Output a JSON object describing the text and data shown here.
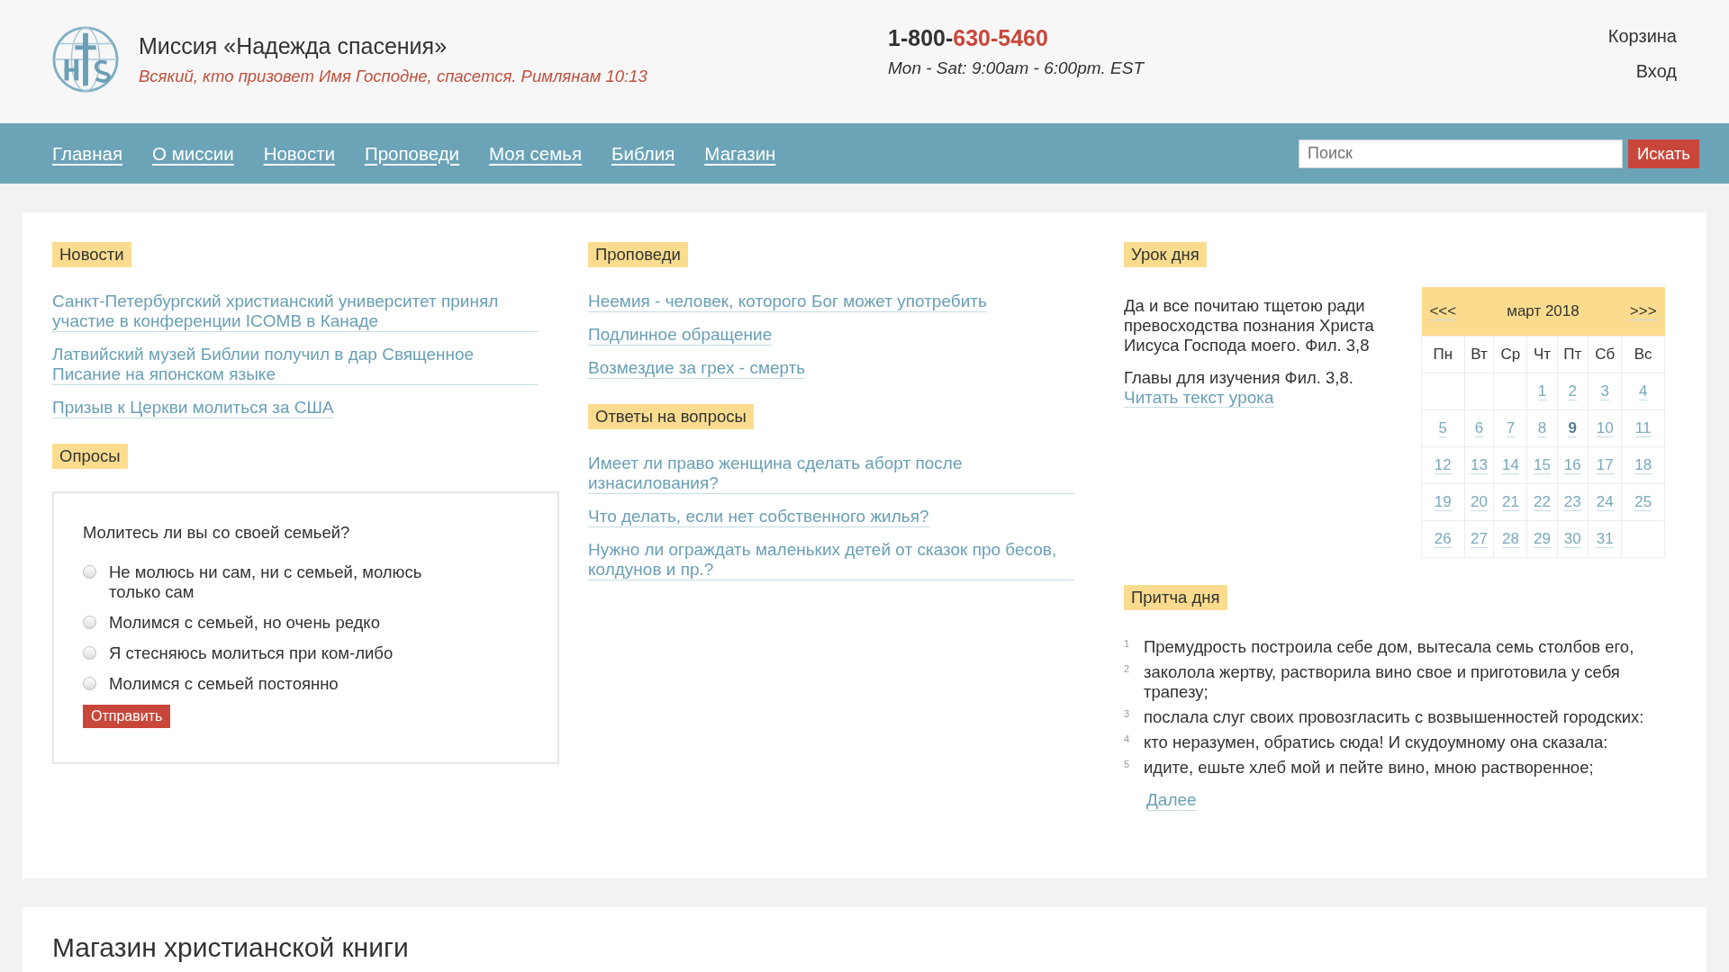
{
  "header": {
    "title": "Миссия «Надежда спасения»",
    "verse": "Всякий, кто призовет Имя Господне, спасется. Римлянам 10:13",
    "phone_prefix": "1-800-",
    "phone_number": "630-5460",
    "hours": "Mon - Sat: 9:00am - 6:00pm. EST",
    "links": [
      "Корзина",
      "Вход"
    ]
  },
  "nav": {
    "items": [
      "Главная",
      "О миссии",
      "Новости",
      "Проповеди",
      "Моя семья",
      "Библия",
      "Магазин"
    ],
    "search": {
      "placeholder": "Поиск"
    },
    "search_button": "Искать"
  },
  "news": {
    "heading": "Новости",
    "items": [
      "Санкт-Петербургский христианский университет принял участие в конференции ICOMB в Канаде",
      "Латвийский музей Библии получил в дар Священное Писание на японском языке",
      "Призыв к Церкви молиться за США"
    ]
  },
  "poll": {
    "heading": "Опросы",
    "question": "Молитесь ли вы со своей семьей?",
    "options": [
      {
        "label": "Не молюсь ни сам, ни с семьей, молюсь только сам",
        "selected": false
      },
      {
        "label": "Молимся с семьей, но очень редко",
        "selected": false
      },
      {
        "label": "Я стесняюсь молиться при ком-либо",
        "selected": false
      },
      {
        "label": "Молимся с семьей постоянно",
        "selected": false
      }
    ],
    "submit": "Отправить"
  },
  "sermons": {
    "heading": "Проповеди",
    "items": [
      "Неемия - человек, которого Бог может употребить",
      "Подлинное обращение",
      "Возмездие за грех - смерть"
    ]
  },
  "answers": {
    "heading": "Ответы на вопросы",
    "items": [
      "Имеет ли право женщина сделать аборт после изнасилования?",
      "Что делать, если нет собственного жилья?",
      "Нужно ли ограждать маленьких детей от сказок про бесов, колдунов и пр.?"
    ]
  },
  "lesson": {
    "heading": "Урок дня",
    "text": "Да и все почитаю тщетою ради превосходства познания Христа Иисуса Господа моего. Фил. 3,8",
    "chapters": "Главы для изучения Фил. 3,8.",
    "link": "Читать текст урока"
  },
  "calendar": {
    "prev": "<<<",
    "month": "март 2018",
    "next": ">>>",
    "weekdays": [
      "Пн",
      "Вт",
      "Ср",
      "Чт",
      "Пт",
      "Сб",
      "Вс"
    ],
    "weeks": [
      [
        {
          "day": "1",
          "selected": false
        },
        {
          "day": "2",
          "selected": false
        },
        {
          "day": "3",
          "selected": false
        },
        {
          "day": "4",
          "selected": false
        }
      ],
      [
        {
          "day": "5",
          "selected": false
        },
        {
          "day": "6",
          "selected": false
        },
        {
          "day": "7",
          "selected": false
        },
        {
          "day": "8",
          "selected": false
        },
        {
          "day": "9",
          "selected": true
        },
        {
          "day": "10",
          "selected": false
        },
        {
          "day": "11",
          "selected": false
        }
      ],
      [
        {
          "day": "12",
          "selected": false
        },
        {
          "day": "13",
          "selected": false
        },
        {
          "day": "14",
          "selected": false
        },
        {
          "day": "15",
          "selected": false
        },
        {
          "day": "16",
          "selected": false
        },
        {
          "day": "17",
          "selected": false
        },
        {
          "day": "18",
          "selected": false
        }
      ],
      [
        {
          "day": "19",
          "selected": false
        },
        {
          "day": "20",
          "selected": false
        },
        {
          "day": "21",
          "selected": false
        },
        {
          "day": "22",
          "selected": false
        },
        {
          "day": "23",
          "selected": false
        },
        {
          "day": "24",
          "selected": false
        },
        {
          "day": "25",
          "selected": false
        }
      ],
      [
        {
          "day": "26",
          "selected": false
        },
        {
          "day": "27",
          "selected": false
        },
        {
          "day": "28",
          "selected": false
        },
        {
          "day": "29",
          "selected": false
        },
        {
          "day": "30",
          "selected": false
        },
        {
          "day": "31",
          "selected": false
        }
      ]
    ]
  },
  "parable": {
    "heading": "Притча дня",
    "verses": [
      {
        "number": "1",
        "text": "Премудрость построила себе дом, вытесала семь столбов его,"
      },
      {
        "number": "2",
        "text": "заколола жертву, растворила вино свое и приготовила у себя трапезу;"
      },
      {
        "number": "3",
        "text": "послала слуг своих провозгласить с возвышенностей городских:"
      },
      {
        "number": "4",
        "text": "кто неразумен, обратись сюда! И скудоумному она сказала:"
      },
      {
        "number": "5",
        "text": "идите, ешьте хлеб мой и пейте вино, мною растворенное;"
      }
    ],
    "more": "Далее"
  },
  "shop": {
    "heading": "Магазин христианской книги"
  }
}
